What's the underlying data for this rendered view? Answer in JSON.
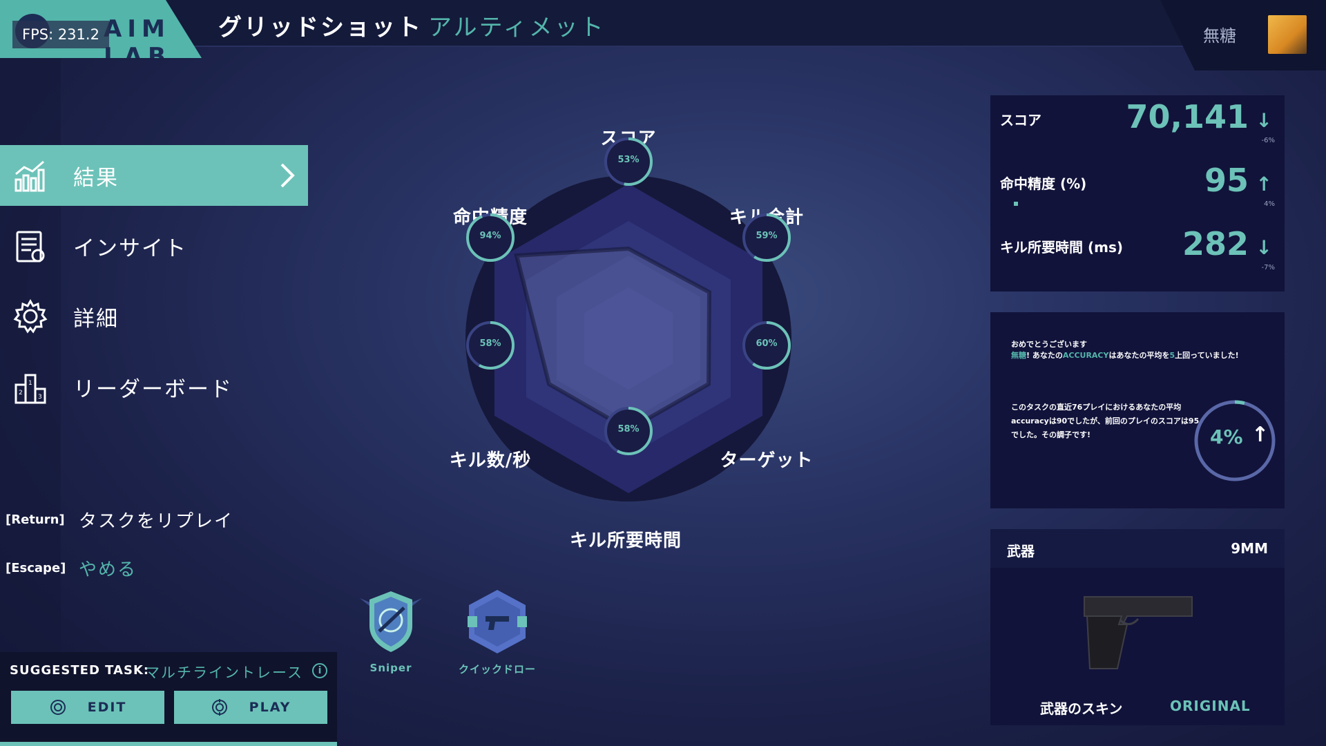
{
  "app": {
    "logo_text": "AIM LAB",
    "fps": "FPS: 231.2"
  },
  "header": {
    "task_title": "グリッドショット",
    "task_subtitle": "アルティメット",
    "username": "無糖"
  },
  "nav": {
    "items": [
      {
        "label": "結果",
        "icon": "chart-icon",
        "active": true
      },
      {
        "label": "インサイト",
        "icon": "clipboard-icon"
      },
      {
        "label": "詳細",
        "icon": "gear-icon"
      },
      {
        "label": "リーダーボード",
        "icon": "podium-icon"
      }
    ]
  },
  "shortcuts": [
    {
      "key": "[Return]",
      "label": "タスクをリプレイ"
    },
    {
      "key": "[Escape]",
      "label": "やめる"
    }
  ],
  "suggested": {
    "label": "SUGGESTED TASK:",
    "task": "マルチライントレース",
    "info_icon": "i",
    "edit_label": "EDIT",
    "play_label": "PLAY"
  },
  "radar": {
    "axes": [
      {
        "label": "スコア",
        "pct": 53
      },
      {
        "label": "キル合計",
        "pct": 59
      },
      {
        "label": "ターゲット",
        "pct": 60
      },
      {
        "label": "キル所要時間",
        "pct": 58
      },
      {
        "label": "キル数/秒",
        "pct": 58
      },
      {
        "label": "命中精度",
        "pct": 94
      }
    ],
    "pct_text": [
      "53%",
      "59%",
      "60%",
      "58%",
      "58%",
      "94%"
    ]
  },
  "badges": [
    {
      "label": "Sniper",
      "icon": "sniper-badge-icon"
    },
    {
      "label": "クイックドロー",
      "icon": "quickdraw-badge-icon"
    }
  ],
  "stats": [
    {
      "name": "スコア",
      "value": "70,141",
      "arrow": "↓",
      "delta": "-6%"
    },
    {
      "name": "命中精度 (%)",
      "value": "95",
      "arrow": "↑",
      "delta": "4%"
    },
    {
      "name": "キル所要時間 (ms)",
      "value": "282",
      "arrow": "↓",
      "delta": "-7%"
    }
  ],
  "message": {
    "line1": "おめでとうございます",
    "line2_user": "無糖",
    "line2_a": "! あなたの",
    "line2_b": "ACCURACY",
    "line2_c": "はあなたの平均を",
    "line2_d": "5",
    "line2_e": "上回っていました!",
    "body": "このタスクの直近76プレイにおけるあなたの平均accuracyは90でしたが、前回のプレイのスコアは95でした。その調子です!",
    "ring_value": "4%",
    "ring_arrow": "↑",
    "ring_fill": 0.04
  },
  "weapon": {
    "label": "武器",
    "value": "9MM",
    "icon": "pistol-icon",
    "skin_label": "武器のスキン",
    "skin_value": "ORIGINAL"
  },
  "colors": {
    "accent": "#6cc2b8",
    "panel": "#11133a",
    "bg": "#1b2148"
  }
}
